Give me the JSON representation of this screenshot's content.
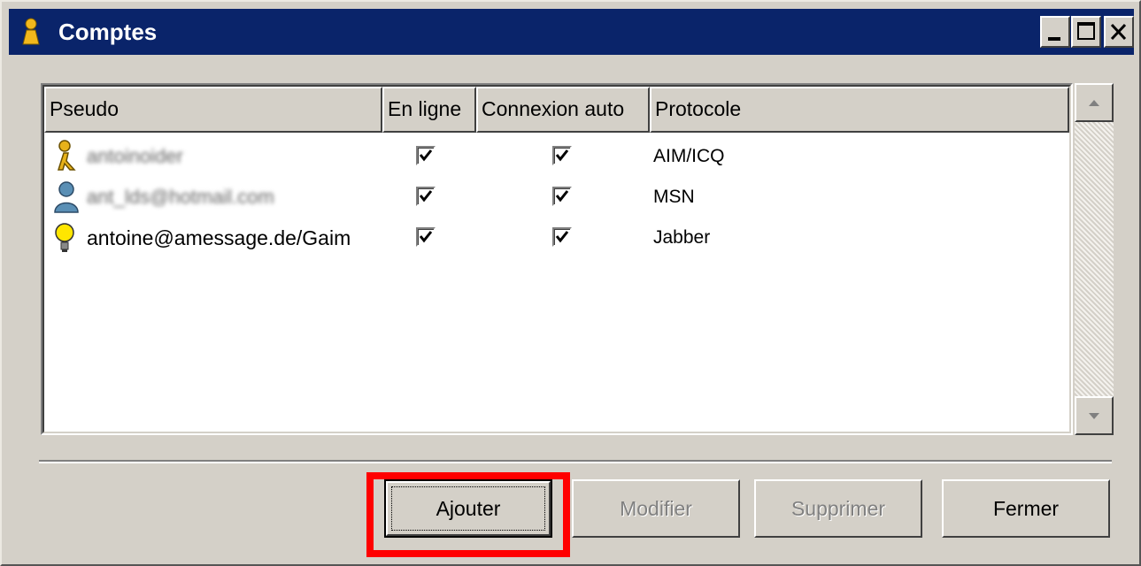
{
  "window": {
    "title": "Comptes",
    "controls": [
      "minimize-icon",
      "maximize-icon",
      "close-icon"
    ]
  },
  "table": {
    "columns": [
      "Pseudo",
      "En ligne",
      "Connexion auto",
      "Protocole"
    ],
    "rows": [
      {
        "pseudo": "antoinoider",
        "pseudo_blurred": true,
        "online": true,
        "auto_connect": true,
        "protocol": "AIM/ICQ",
        "icon": "aim-runner-icon"
      },
      {
        "pseudo": "ant_lds@hotmail.com",
        "pseudo_blurred": true,
        "online": true,
        "auto_connect": true,
        "protocol": "MSN",
        "icon": "msn-buddy-icon"
      },
      {
        "pseudo": "antoine@amessage.de/Gaim",
        "pseudo_blurred": false,
        "online": true,
        "auto_connect": true,
        "protocol": "Jabber",
        "icon": "jabber-lightbulb-icon"
      }
    ]
  },
  "buttons": {
    "add": "Ajouter",
    "modify": "Modifier",
    "delete": "Supprimer",
    "close": "Fermer"
  },
  "colors": {
    "titlebar": "#0a246a",
    "highlight": "#ff0000",
    "face": "#d4d0c8"
  }
}
